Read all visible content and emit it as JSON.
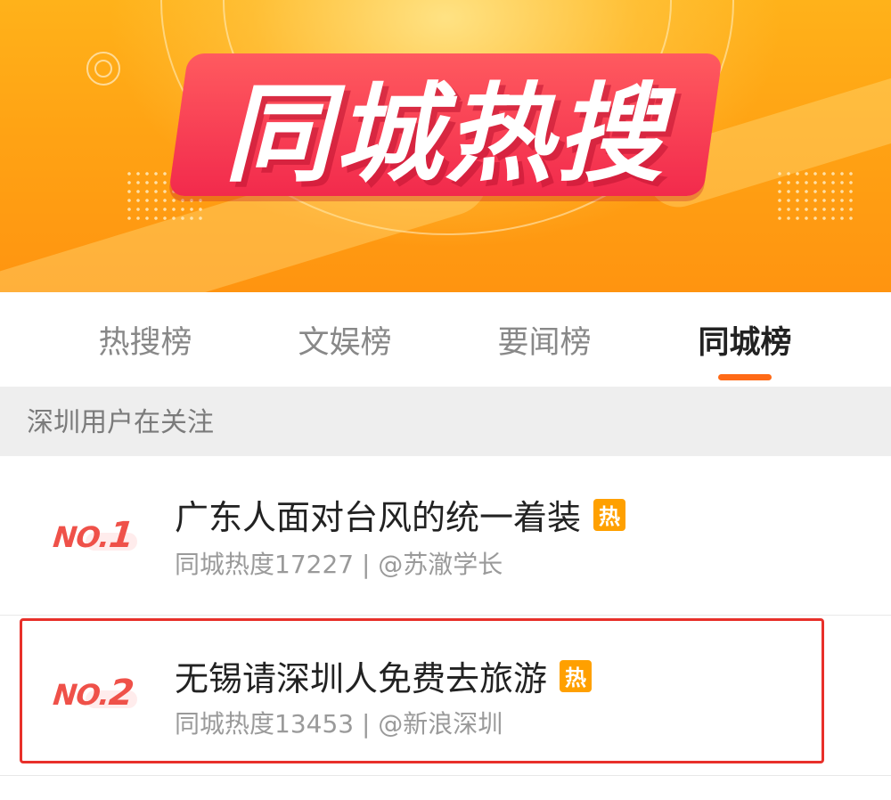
{
  "banner": {
    "title": "同城热搜",
    "colors": {
      "background": "#ffa314",
      "title_box": "#f22a4c"
    }
  },
  "tabs": [
    {
      "label": "热搜榜",
      "active": false
    },
    {
      "label": "文娱榜",
      "active": false
    },
    {
      "label": "要闻榜",
      "active": false
    },
    {
      "label": "同城榜",
      "active": true
    }
  ],
  "section": {
    "label": "深圳用户在关注"
  },
  "items": [
    {
      "rank_prefix": "NO.",
      "rank_number": "1",
      "title": "广东人面对台风的统一着装",
      "badge": "热",
      "meta": "同城热度17227 | @苏澈学长"
    },
    {
      "rank_prefix": "NO.",
      "rank_number": "2",
      "title": "无锡请深圳人免费去旅游",
      "badge": "热",
      "meta": "同城热度13453 | @新浪深圳"
    }
  ],
  "colors": {
    "accent": "#ff6a16",
    "rank_red": "#ef5149",
    "hot_badge": "#ffa000",
    "highlight_border": "#e8302a"
  }
}
